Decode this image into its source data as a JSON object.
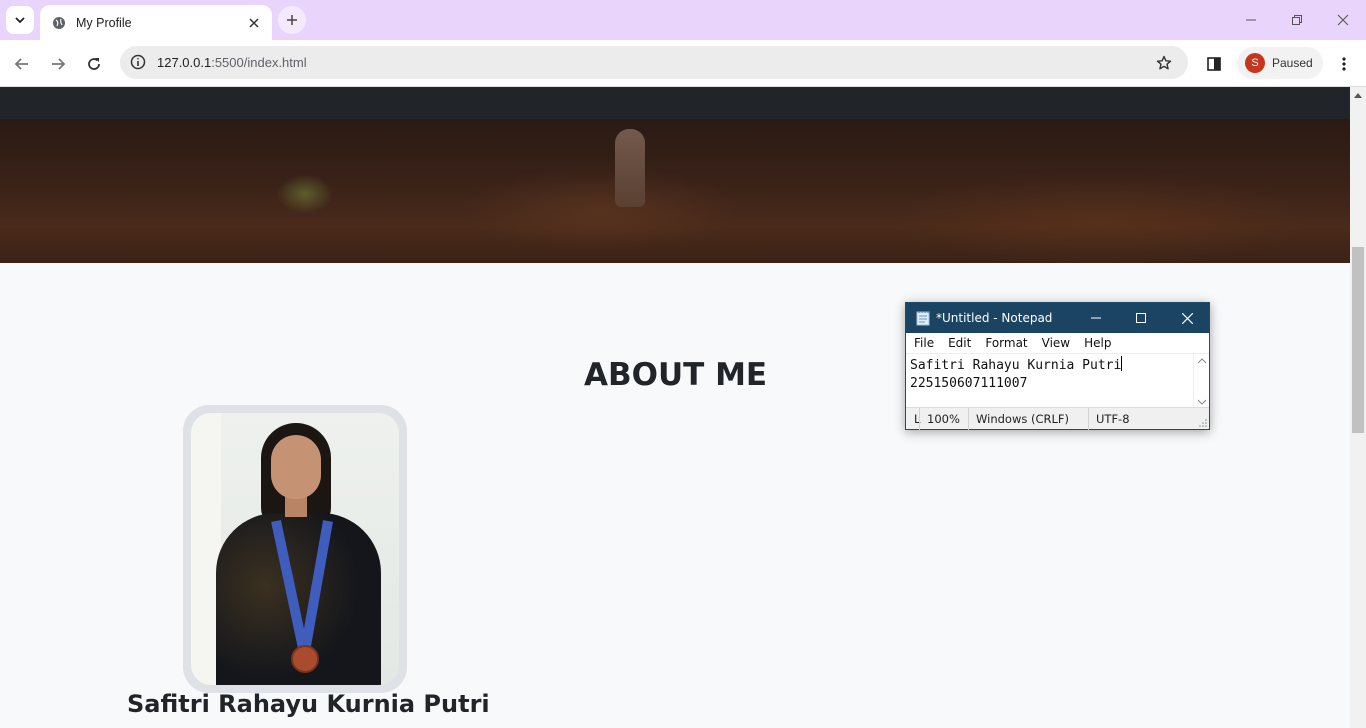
{
  "browser": {
    "tab_title": "My Profile",
    "url_host": "127.0.0.1",
    "url_path": ":5500/index.html",
    "profile_initial": "S",
    "profile_status": "Paused",
    "accent": "#e9d5fb",
    "avatar_color": "#c5361c"
  },
  "page": {
    "section_title": "ABOUT ME",
    "profile_name": "Safitri Rahayu Kurnia Putri"
  },
  "notepad": {
    "title": "*Untitled - Notepad",
    "menu": [
      "File",
      "Edit",
      "Format",
      "View",
      "Help"
    ],
    "line1": "Safitri Rahayu Kurnia Putri",
    "line2": "225150607111007",
    "status_position": "L",
    "status_zoom": "100%",
    "status_eol": "Windows (CRLF)",
    "status_encoding": "UTF-8"
  }
}
